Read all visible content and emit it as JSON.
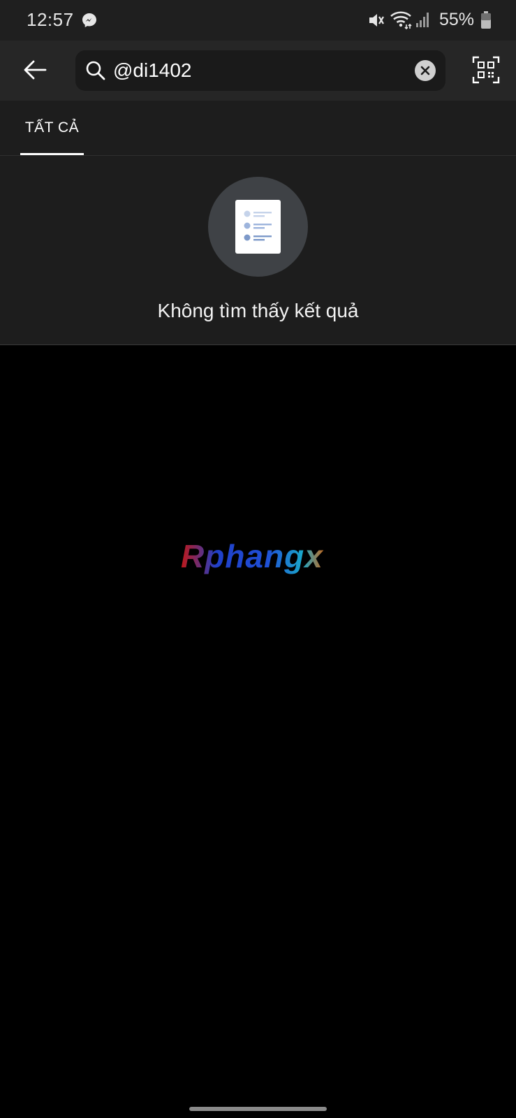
{
  "status_bar": {
    "time": "12:57",
    "battery_percent": "55%",
    "icons": [
      "messenger-icon",
      "mute-icon",
      "wifi-icon",
      "signal-icon",
      "battery-icon"
    ]
  },
  "header": {
    "search": {
      "value": "@di1402"
    },
    "icons": [
      "back-arrow-icon",
      "search-icon",
      "clear-icon",
      "qr-code-icon"
    ]
  },
  "tabs": [
    {
      "label": "TẤT CẢ",
      "active": true
    }
  ],
  "empty_state": {
    "message": "Không tìm thấy kết quả",
    "icon": "document-list-icon"
  },
  "watermark": {
    "text": "Rphangx"
  },
  "colors": {
    "background": "#000000",
    "header": "#262626",
    "panel": "#1d1d1d",
    "accent_circle": "#3f4246",
    "watermark_red": "#c01818",
    "watermark_blue": "#1f4fd6",
    "watermark_cyan": "#1aa7c9",
    "watermark_orange": "#c86a1e"
  }
}
